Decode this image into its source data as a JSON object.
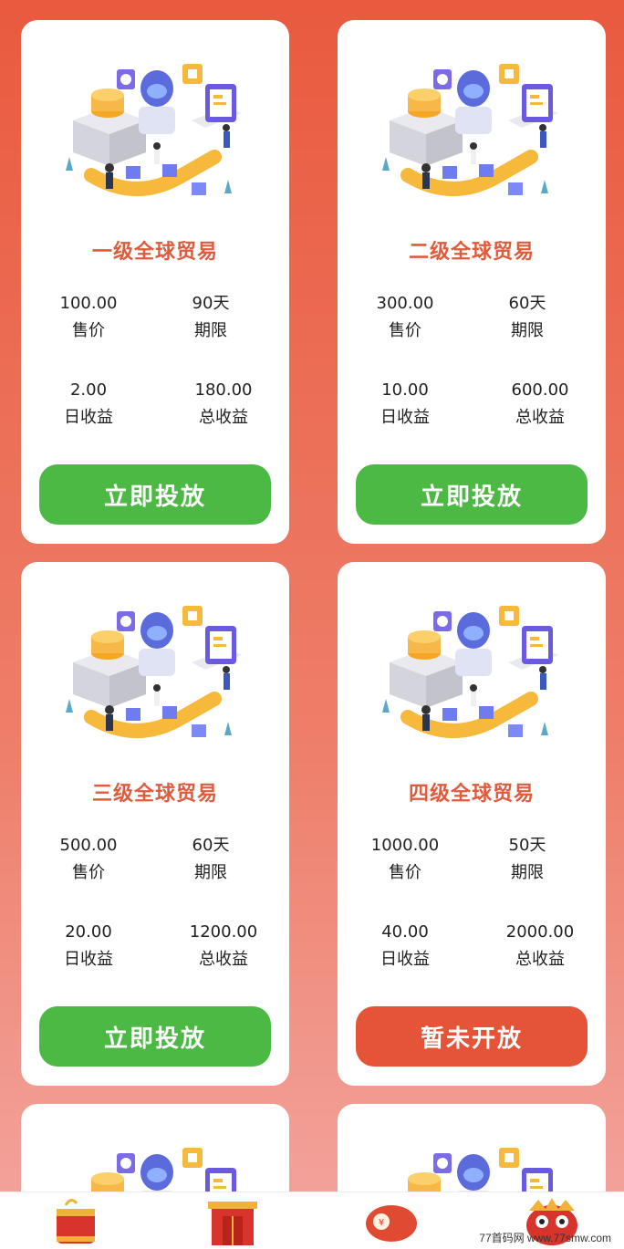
{
  "products": [
    {
      "title": "一级全球贸易",
      "price": "100.00",
      "price_label": "售价",
      "term": "90天",
      "term_label": "期限",
      "daily": "2.00",
      "daily_label": "日收益",
      "total": "180.00",
      "total_label": "总收益",
      "button": "立即投放",
      "button_state": "active"
    },
    {
      "title": "二级全球贸易",
      "price": "300.00",
      "price_label": "售价",
      "term": "60天",
      "term_label": "期限",
      "daily": "10.00",
      "daily_label": "日收益",
      "total": "600.00",
      "total_label": "总收益",
      "button": "立即投放",
      "button_state": "active"
    },
    {
      "title": "三级全球贸易",
      "price": "500.00",
      "price_label": "售价",
      "term": "60天",
      "term_label": "期限",
      "daily": "20.00",
      "daily_label": "日收益",
      "total": "1200.00",
      "total_label": "总收益",
      "button": "立即投放",
      "button_state": "active"
    },
    {
      "title": "四级全球贸易",
      "price": "1000.00",
      "price_label": "售价",
      "term": "50天",
      "term_label": "期限",
      "daily": "40.00",
      "daily_label": "日收益",
      "total": "2000.00",
      "total_label": "总收益",
      "button": "暂未开放",
      "button_state": "disabled"
    }
  ],
  "bottom_nav": {
    "items": [
      {
        "icon": "firecracker-icon"
      },
      {
        "icon": "gate-icon"
      },
      {
        "icon": "red-envelope-icon"
      },
      {
        "icon": "lion-head-icon"
      }
    ]
  },
  "watermark": "77首码网 www.77smw.com",
  "colors": {
    "background_top": "#e95a3f",
    "title": "#e05a3c",
    "button_active": "#4cb944",
    "button_disabled": "#e55438"
  }
}
